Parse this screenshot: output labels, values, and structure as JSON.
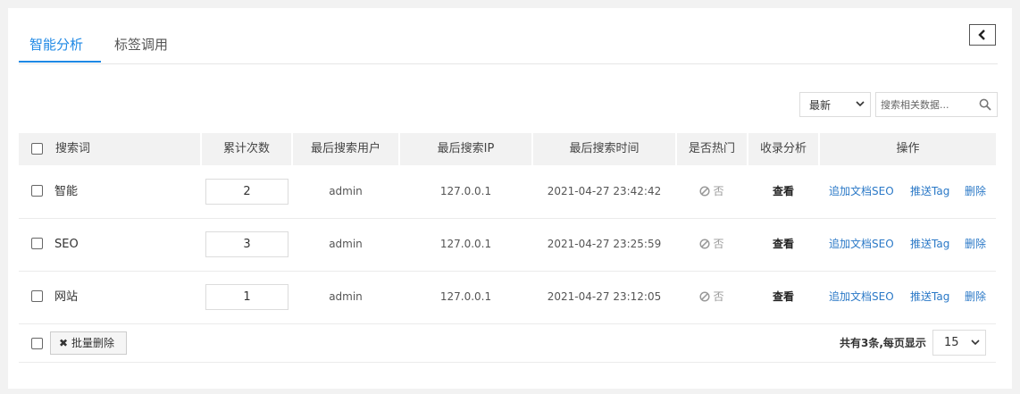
{
  "tabs": [
    {
      "label": "智能分析",
      "active": true
    },
    {
      "label": "标签调用",
      "active": false
    }
  ],
  "toolbar": {
    "sort_value": "最新",
    "search_placeholder": "搜索相关数据..."
  },
  "table": {
    "headers": {
      "keyword": "搜索词",
      "count": "累计次数",
      "last_user": "最后搜索用户",
      "last_ip": "最后搜索IP",
      "last_time": "最后搜索时间",
      "hot": "是否热门",
      "index": "收录分析",
      "ops": "操作"
    },
    "rows": [
      {
        "keyword": "智能",
        "count": "2",
        "user": "admin",
        "ip": "127.0.0.1",
        "time": "2021-04-27 23:42:42",
        "hot": "否",
        "index": "查看",
        "op1": "追加文档SEO",
        "op2": "推送Tag",
        "op3": "删除"
      },
      {
        "keyword": "SEO",
        "count": "3",
        "user": "admin",
        "ip": "127.0.0.1",
        "time": "2021-04-27 23:25:59",
        "hot": "否",
        "index": "查看",
        "op1": "追加文档SEO",
        "op2": "推送Tag",
        "op3": "删除"
      },
      {
        "keyword": "网站",
        "count": "1",
        "user": "admin",
        "ip": "127.0.0.1",
        "time": "2021-04-27 23:12:05",
        "hot": "否",
        "index": "查看",
        "op1": "追加文档SEO",
        "op2": "推送Tag",
        "op3": "删除"
      }
    ]
  },
  "footer": {
    "batch_delete": "批量删除",
    "total_text": "共有3条,每页显示",
    "page_size": "15"
  },
  "icons": {
    "collapse": "chevron-left-icon",
    "search": "search-icon",
    "hot": "ban-icon",
    "batch": "close-icon"
  },
  "colors": {
    "accent": "#1e88e5",
    "link": "#2b79c7"
  }
}
